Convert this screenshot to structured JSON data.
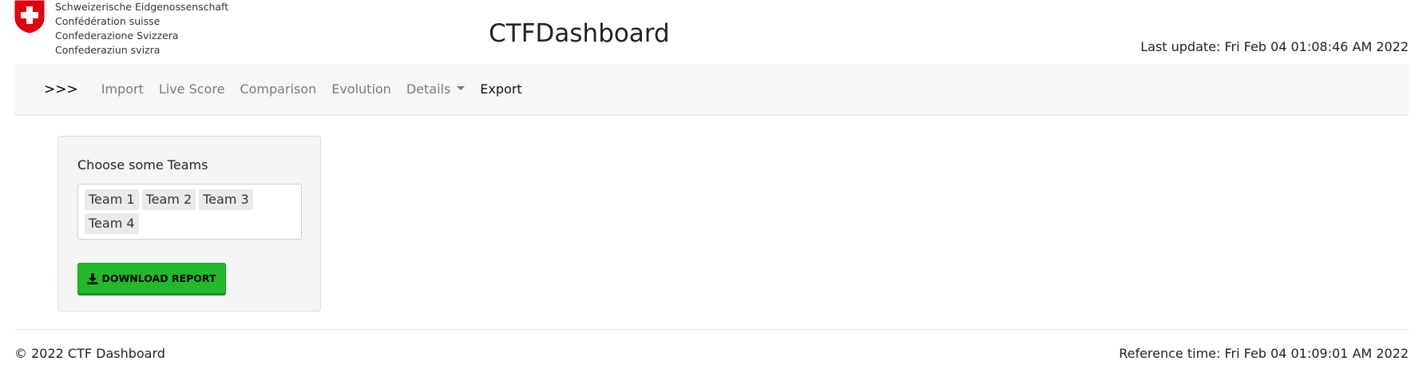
{
  "header": {
    "federal_names": [
      "Schweizerische Eidgenossenschaft",
      "Confédération suisse",
      "Confederazione Svizzera",
      "Confederaziun svizra"
    ],
    "title": "CTFDashboard",
    "last_update": "Last update: Fri Feb 04 01:08:46 AM 2022",
    "logo_icon": "swiss-coat-of-arms-icon",
    "colors": {
      "logo_red": "#e3000f"
    }
  },
  "navbar": {
    "brand": ">>>",
    "items": [
      {
        "label": "Import"
      },
      {
        "label": "Live Score"
      },
      {
        "label": "Comparison"
      },
      {
        "label": "Evolution"
      },
      {
        "label": "Details",
        "dropdown": true
      },
      {
        "label": "Export",
        "active": true
      }
    ]
  },
  "main": {
    "teams_label": "Choose some Teams",
    "selected_teams": [
      "Team 1",
      "Team 2",
      "Team 3",
      "Team 4"
    ],
    "download_button": {
      "label": "DOWNLOAD REPORT",
      "icon": "download-icon",
      "color": "#22b92a"
    }
  },
  "footer": {
    "copyright": "© 2022 CTF Dashboard",
    "reference_time": "Reference time: Fri Feb 04 01:09:01 AM 2022"
  }
}
